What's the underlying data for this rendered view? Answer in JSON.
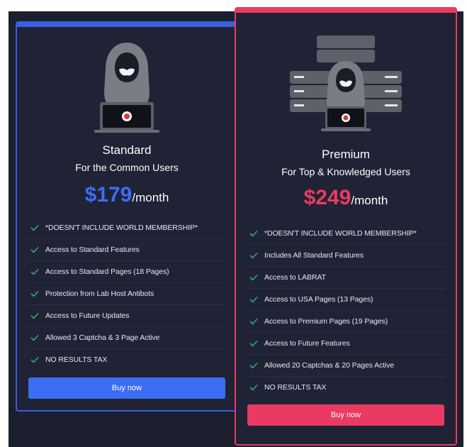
{
  "colors": {
    "background": "#1b1f2e",
    "card": "#1f2335",
    "standard_accent": "#3b5fe0",
    "standard_button": "#3b6ef2",
    "premium_accent": "#ea3a61",
    "check": "#3aa86a"
  },
  "plans": {
    "standard": {
      "icon": "hacker-laptop-icon",
      "name": "Standard",
      "tagline": "For the Common Users",
      "price": "$179",
      "period": "/month",
      "features": [
        "*DOESN'T INCLUDE WORLD MEMBERSHIP*",
        "Access to Standard Features",
        "Access to Standard Pages (18 Pages)",
        "Protection from Lab Host Antibots",
        "Access to Future Updates",
        "Allowed 3 Captcha & 3 Page Active",
        "NO RESULTS TAX"
      ],
      "button": "Buy now"
    },
    "premium": {
      "icon": "hacker-servers-icon",
      "name": "Premium",
      "tagline": "For Top & Knowledged Users",
      "price": "$249",
      "period": "/month",
      "features": [
        "*DOESN'T INCLUDE WORLD MEMBERSHIP*",
        "Includes All Standard Features",
        "Access to LABRAT",
        "Access to USA Pages (13 Pages)",
        "Access to Premium Pages (19 Pages)",
        "Access to Future Features",
        "Allowed 20 Captchas & 20 Pages Active",
        "NO RESULTS TAX"
      ],
      "button": "Buy now"
    }
  }
}
